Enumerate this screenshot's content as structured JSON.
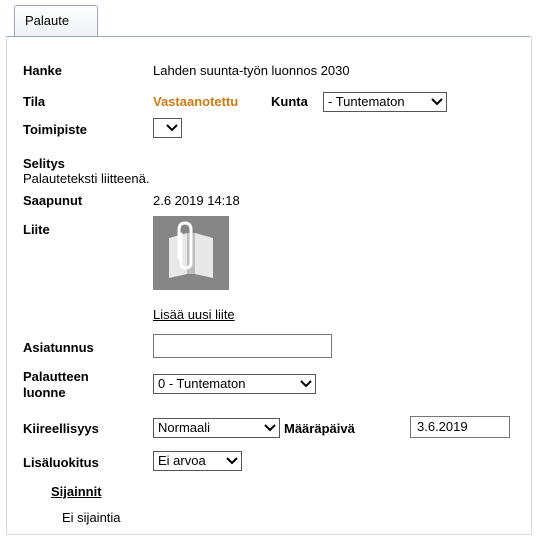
{
  "tabs": [
    {
      "label": "Palaute"
    }
  ],
  "fields": {
    "hanke": {
      "label": "Hanke",
      "value": "Lahden suunta-työn luonnos 2030"
    },
    "tila": {
      "label": "Tila",
      "value": "Vastaanotettu"
    },
    "kunta": {
      "label": "Kunta",
      "value": "- Tuntematon"
    },
    "toimipiste": {
      "label": "Toimipiste",
      "value": ""
    },
    "selitys": {
      "label": "Selitys",
      "value": "Palauteteksti liitteenä."
    },
    "saapunut": {
      "label": "Saapunut",
      "value": "2.6 2019 14:18"
    },
    "liite": {
      "label": "Liite",
      "add_link": "Lisää uusi liite"
    },
    "asiatunnus": {
      "label": "Asiatunnus",
      "value": ""
    },
    "luonne": {
      "label_line1": "Palautteen",
      "label_line2": "luonne",
      "value": "0 - Tuntematon"
    },
    "kiireellisyys": {
      "label": "Kiireellisyys",
      "value": "Normaali"
    },
    "maarapaiva": {
      "label": "Määräpäivä",
      "value": "3.6.2019"
    },
    "lisaluokitus": {
      "label": "Lisäluokitus",
      "value": "Ei arvoa"
    }
  },
  "sijainnit": {
    "heading": "Sijainnit",
    "empty_text": "Ei sijaintia"
  },
  "colors": {
    "status": "#d07a12",
    "tab_border": "#9ca8b8",
    "thumb_bg": "#868686"
  }
}
